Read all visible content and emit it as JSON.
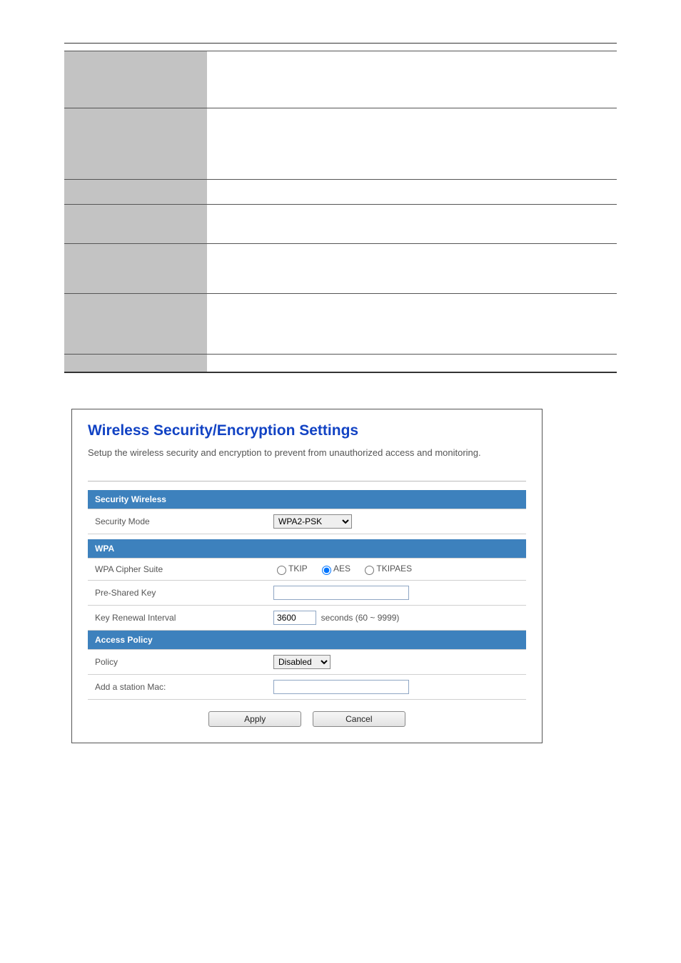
{
  "panel": {
    "title": "Wireless Security/Encryption Settings",
    "description": "Setup the wireless security and encryption to prevent from unauthorized access and monitoring."
  },
  "sections": {
    "security_wireless": "Security Wireless",
    "wpa": "WPA",
    "access_policy": "Access Policy"
  },
  "fields": {
    "security_mode": {
      "label": "Security Mode",
      "value": "WPA2-PSK"
    },
    "wpa_cipher": {
      "label": "WPA Cipher Suite",
      "options": {
        "tkip": "TKIP",
        "aes": "AES",
        "tkipaes": "TKIPAES"
      },
      "selected": "AES"
    },
    "psk": {
      "label": "Pre-Shared Key",
      "value": ""
    },
    "key_renewal": {
      "label": "Key Renewal Interval",
      "value": "3600",
      "suffix": "seconds  (60 ~ 9999)"
    },
    "policy": {
      "label": "Policy",
      "value": "Disabled"
    },
    "add_mac": {
      "label": "Add a station Mac:",
      "value": ""
    }
  },
  "buttons": {
    "apply": "Apply",
    "cancel": "Cancel"
  }
}
